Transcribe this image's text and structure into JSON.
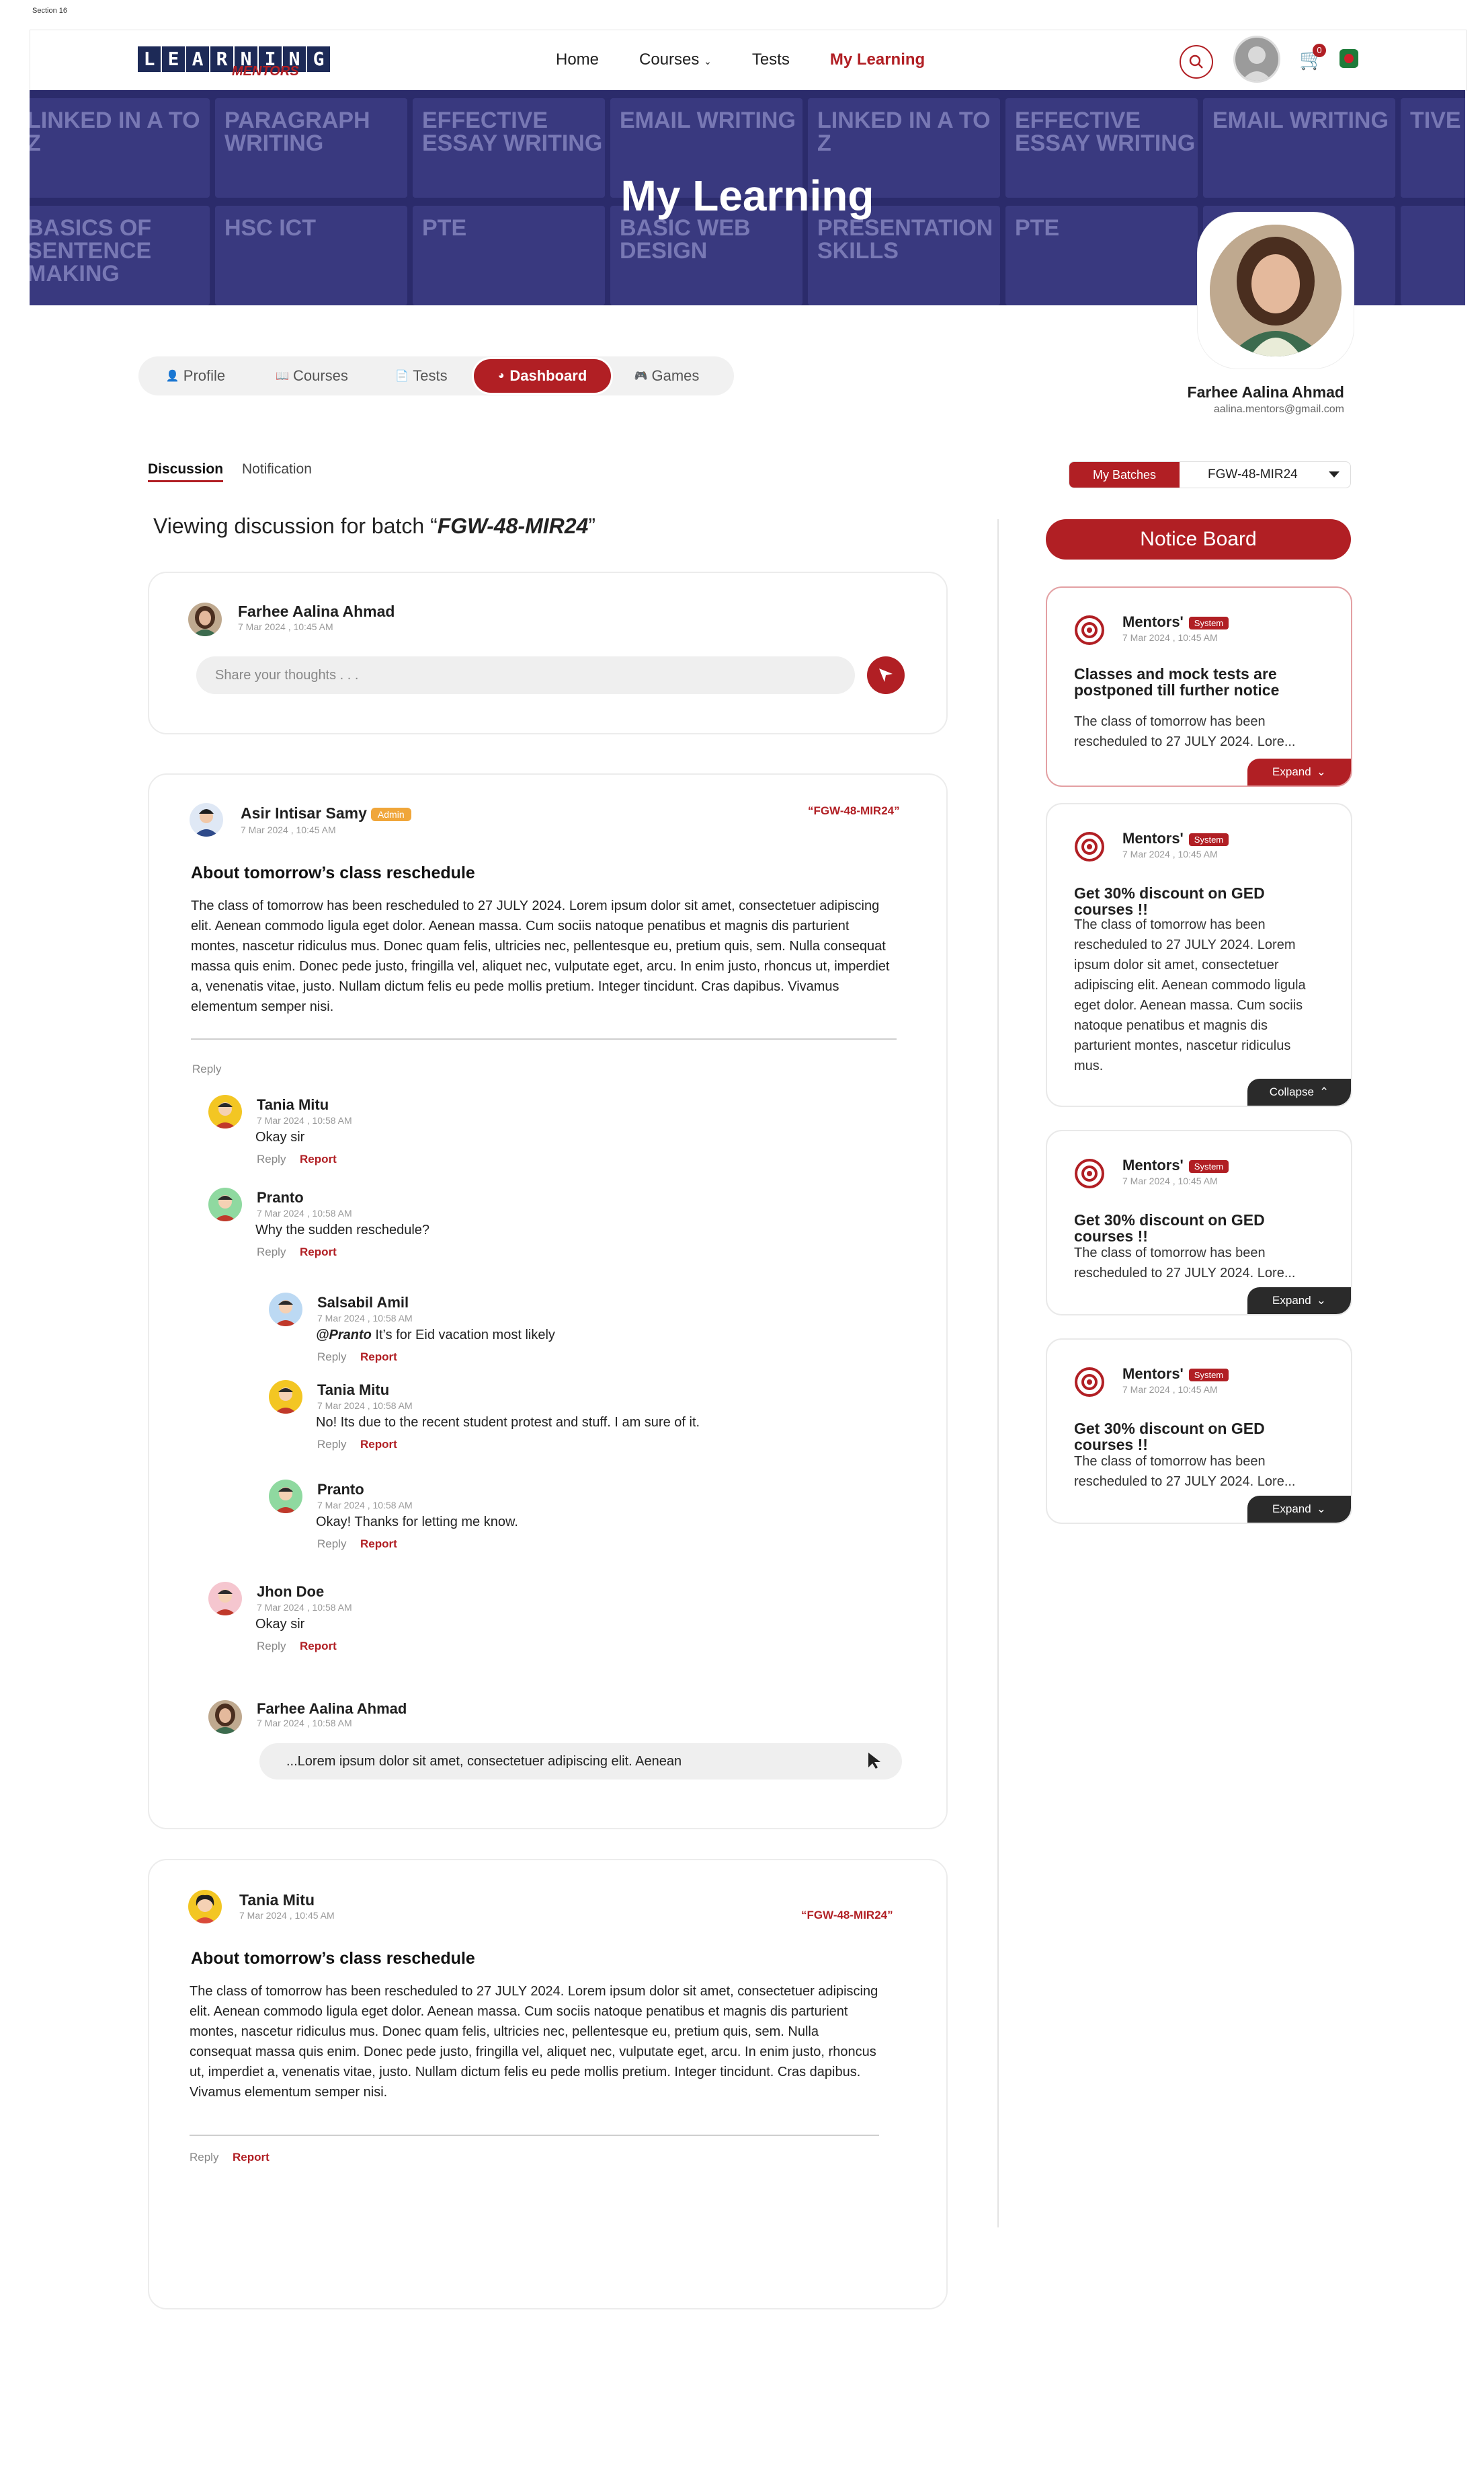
{
  "section_label": "Section 16",
  "brand": {
    "logo_main": "LEARNING",
    "logo_sub": "MENTORS"
  },
  "nav": {
    "home": "Home",
    "courses": "Courses",
    "tests": "Tests",
    "my_learning": "My Learning"
  },
  "cart_count": "0",
  "banner": {
    "title": "My Learning",
    "tiles": [
      "LINKED IN A TO Z",
      "PARAGRAPH WRITING",
      "EFFECTIVE ESSAY WRITING",
      "EMAIL WRITING",
      "LINKED IN A TO Z",
      "EFFECTIVE ESSAY WRITING",
      "EMAIL WRITING",
      "TIVE ING",
      "BASICS OF SENTENCE MAKING",
      "HSC ICT",
      "PTE",
      "BASIC WEB DESIGN",
      "PRESENTATION SKILLS",
      "PTE",
      "",
      ""
    ]
  },
  "profile": {
    "name": "Farhee Aalina Ahmad",
    "email": "aalina.mentors@gmail.com"
  },
  "tabs": {
    "profile": "Profile",
    "courses": "Courses",
    "tests": "Tests",
    "dashboard": "Dashboard",
    "games": "Games"
  },
  "subtabs": {
    "discussion": "Discussion",
    "notification": "Notification"
  },
  "batch": {
    "label": "My Batches",
    "value": "FGW-48-MIR24"
  },
  "viewing": {
    "prefix": "Viewing discussion for batch “",
    "batch": "FGW-48-MIR24",
    "suffix": "”"
  },
  "composer": {
    "name": "Farhee Aalina Ahmad",
    "time": "7 Mar 2024 , 10:45 AM",
    "placeholder": "Share your thoughts . . ."
  },
  "post1": {
    "author": "Asir Intisar Samy",
    "badge": "Admin",
    "time": "7 Mar 2024 , 10:45 AM",
    "batch_tag": "“FGW-48-MIR24”",
    "title": "About tomorrow’s class reschedule",
    "body": "The class of tomorrow has been rescheduled to 27 JULY 2024. Lorem ipsum dolor sit amet, consectetuer adipiscing elit. Aenean commodo ligula eget dolor. Aenean massa. Cum sociis natoque penatibus et magnis dis parturient montes, nascetur ridiculus mus. Donec quam felis, ultricies nec, pellentesque eu, pretium quis, sem. Nulla consequat massa quis enim. Donec pede justo, fringilla vel, aliquet nec, vulputate eget, arcu. In enim justo, rhoncus ut, imperdiet a, venenatis vitae, justo. Nullam dictum felis eu pede mollis pretium. Integer tincidunt. Cras dapibus. Vivamus elementum semper nisi.",
    "reply_label": "Reply",
    "replies": [
      {
        "name": "Tania Mitu",
        "time": "7 Mar 2024 , 10:58 AM",
        "text": "Okay sir",
        "reply": "Reply",
        "report": "Report"
      },
      {
        "name": "Pranto",
        "time": "7 Mar 2024 , 10:58 AM",
        "text": "Why the sudden reschedule?",
        "reply": "Reply",
        "report": "Report"
      },
      {
        "name": "Salsabil Amil",
        "time": "7 Mar 2024 , 10:58 AM",
        "mention": "@Pranto",
        "text": " It’s for Eid vacation most likely",
        "reply": "Reply",
        "report": "Report"
      },
      {
        "name": "Tania Mitu",
        "time": "7 Mar 2024 , 10:58 AM",
        "text": "No! Its due to the recent student protest and stuff. I am sure of it.",
        "reply": "Reply",
        "report": "Report"
      },
      {
        "name": "Pranto",
        "time": "7 Mar 2024 , 10:58 AM",
        "text": "Okay! Thanks for letting me know.",
        "reply": "Reply",
        "report": "Report"
      },
      {
        "name": "Jhon Doe",
        "time": "7 Mar 2024 , 10:58 AM",
        "text": "Okay sir",
        "reply": "Reply",
        "report": "Report"
      }
    ],
    "reply_box": {
      "name": "Farhee Aalina Ahmad",
      "time": "7 Mar 2024 , 10:58 AM",
      "value": "...Lorem ipsum dolor sit amet, consectetuer adipiscing elit. Aenean"
    }
  },
  "post2": {
    "author": "Tania Mitu",
    "time": "7 Mar 2024 , 10:45 AM",
    "batch_tag": "“FGW-48-MIR24”",
    "title": "About tomorrow’s class reschedule",
    "body": "The class of tomorrow has been rescheduled to 27 JULY 2024. Lorem ipsum dolor sit amet, consectetuer adipiscing elit. Aenean commodo ligula eget dolor. Aenean massa. Cum sociis natoque penatibus et magnis dis parturient montes, nascetur ridiculus mus. Donec quam felis, ultricies nec, pellentesque eu, pretium quis, sem. Nulla consequat massa quis enim. Donec pede justo, fringilla vel, aliquet nec, vulputate eget, arcu. In enim justo, rhoncus ut, imperdiet a, venenatis vitae, justo. Nullam dictum felis eu pede mollis pretium. Integer tincidunt. Cras dapibus. Vivamus elementum semper nisi.",
    "reply": "Reply",
    "report": "Report"
  },
  "notice_board": {
    "title": "Notice Board",
    "notices": [
      {
        "source": "Mentors'",
        "tag": "System",
        "time": "7 Mar 2024 , 10:45 AM",
        "title": "Classes and mock tests are postponed till further notice",
        "body": "The class of tomorrow has been rescheduled to 27 JULY 2024. Lore...",
        "button": "Expand"
      },
      {
        "source": "Mentors'",
        "tag": "System",
        "time": "7 Mar 2024 , 10:45 AM",
        "title": "Get 30% discount on GED courses !!",
        "body": "The class of tomorrow has been rescheduled to 27 JULY 2024. Lorem ipsum dolor sit amet, consectetuer adipiscing elit. Aenean commodo ligula eget dolor. Aenean massa. Cum sociis natoque penatibus et magnis dis parturient montes, nascetur ridiculus mus.",
        "button": "Collapse"
      },
      {
        "source": "Mentors'",
        "tag": "System",
        "time": "7 Mar 2024 , 10:45 AM",
        "title": "Get 30% discount on GED courses !!",
        "body": "The class of tomorrow has been rescheduled to 27 JULY 2024. Lore...",
        "button": "Expand"
      },
      {
        "source": "Mentors'",
        "tag": "System",
        "time": "7 Mar 2024 , 10:45 AM",
        "title": "Get 30% discount on GED courses !!",
        "body": "The class of tomorrow has been rescheduled to 27 JULY 2024. Lore...",
        "button": "Expand"
      }
    ]
  }
}
